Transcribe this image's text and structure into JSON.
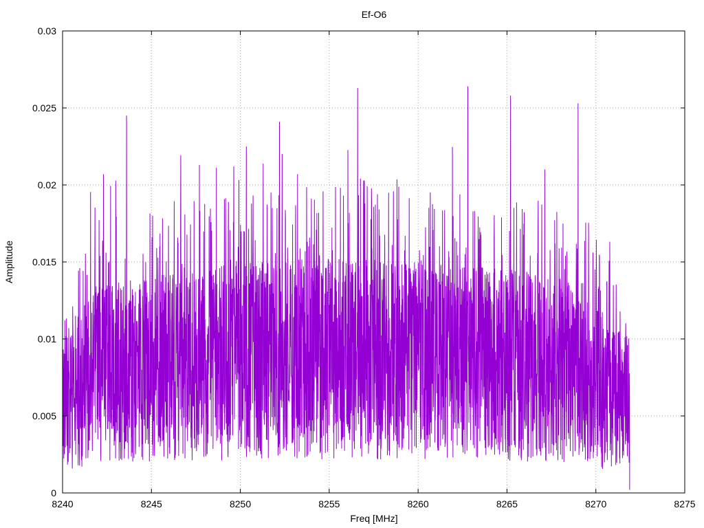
{
  "chart_data": {
    "type": "line",
    "title": "Ef-O6",
    "xlabel": "Freq [MHz]",
    "ylabel": "Amplitude",
    "xlim": [
      8240,
      8275
    ],
    "ylim": [
      0,
      0.03
    ],
    "x_ticks": [
      8240,
      8245,
      8250,
      8255,
      8260,
      8265,
      8270,
      8275
    ],
    "x_tick_labels": [
      "8240",
      "8245",
      "8250",
      "8255",
      "8260",
      "8265",
      "8270",
      "8275"
    ],
    "y_ticks": [
      0,
      0.005,
      0.01,
      0.015,
      0.02,
      0.025,
      0.03
    ],
    "y_tick_labels": [
      "0",
      "0.005",
      "0.01",
      "0.015",
      "0.02",
      "0.025",
      "0.03"
    ],
    "grid": true,
    "legend": "none",
    "series": [
      {
        "color": "#9400d3",
        "x_range": [
          8240,
          8271.9
        ],
        "notable_peaks": [
          {
            "x": 8242.3,
            "y": 0.0207
          },
          {
            "x": 8243.6,
            "y": 0.0245
          },
          {
            "x": 8247.7,
            "y": 0.0213
          },
          {
            "x": 8252.2,
            "y": 0.0241
          },
          {
            "x": 8256.6,
            "y": 0.0263
          },
          {
            "x": 8262.8,
            "y": 0.0264
          },
          {
            "x": 8265.2,
            "y": 0.0258
          },
          {
            "x": 8269.0,
            "y": 0.0253
          }
        ]
      }
    ]
  }
}
